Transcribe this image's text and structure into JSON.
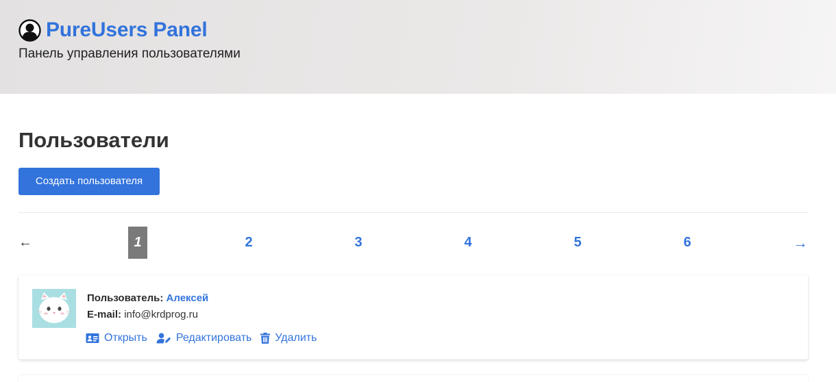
{
  "header": {
    "title": "PureUsers Panel",
    "subtitle": "Панель управления пользователями",
    "icon": "user-circle-icon"
  },
  "main": {
    "title": "Пользователи",
    "create_button": "Создать пользователя"
  },
  "pagination": {
    "prev": "←",
    "next": "→",
    "current_page": "1",
    "pages": [
      "2",
      "3",
      "4",
      "5",
      "6"
    ]
  },
  "users": [
    {
      "name_label": "Пользователь:",
      "name": "Алексей",
      "email_label": "E-mail:",
      "email": "info@krdprog.ru",
      "avatar": "cat-avatar",
      "actions": {
        "open": "Открыть",
        "edit": "Редактировать",
        "delete": "Удалить"
      }
    }
  ],
  "colors": {
    "accent": "#3273dc",
    "current_page_bg": "#7a7a7a",
    "header_bg": "#e8e6e6"
  }
}
